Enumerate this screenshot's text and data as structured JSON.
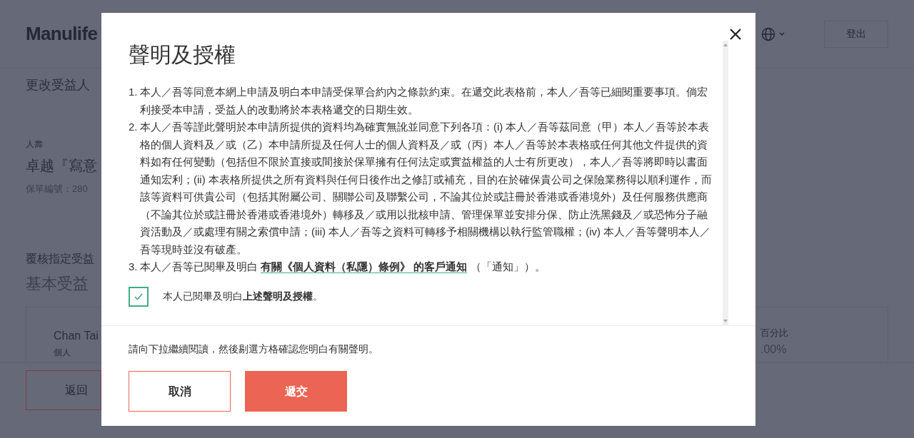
{
  "page": {
    "logo": "Manulife",
    "logout": "登出",
    "heading": "更改受益人",
    "category": "人壽",
    "plan": "卓越『寫意",
    "policy_label": "保單編號：280",
    "review": "覆核指定受益",
    "section": "基本受益",
    "beneficiary": {
      "name": "Chan Tai",
      "type": "個人",
      "percent_label": "百分比",
      "percent": ".00%"
    },
    "back": "返回"
  },
  "dialog": {
    "title": "聲明及授權",
    "items": [
      {
        "kind": "text",
        "number": "1.",
        "text": "本人／吾等同意本網上申請及明白本申請受保單合約內之條款約束。在遞交此表格前，本人／吾等已細閱重要事項。倘宏利接受本申請，受益人的改動將於本表格遞交的日期生效。"
      },
      {
        "kind": "text",
        "number": "2.",
        "text": "本人／吾等謹此聲明於本申請所提供的資料均為確實無訛並同意下列各項：(i) 本人／吾等茲同意（甲）本人／吾等於本表格的個人資料及／或（乙）本申請所提及任何人士的個人資料及／或（丙）本人／吾等於本表格或任何其他文件提供的資料如有任何變動（包括但不限於直接或間接於保單擁有任何法定或實益權益的人士有所更改），本人／吾等將即時以書面通知宏利；(ii) 本表格所提供之所有資料與任何日後作出之修訂或補充，目的在於確保貴公司之保險業務得以順利運作，而該等資料可供貴公司（包括其附屬公司、關聯公司及聯繫公司，不論其位於或註冊於香港或香港境外）及任何服務供應商（不論其位於或註冊於香港或香港境外）轉移及／或用以批核申請、管理保單並安排分保、防止洗黑錢及／或恐怖分子融資活動及／或處理有關之索償申請；(iii) 本人／吾等之資料可轉移予相關機構以執行監管職權；(iv) 本人／吾等聲明本人／吾等現時並沒有破產。"
      },
      {
        "kind": "link",
        "number": "3.",
        "text": "本人／吾等已閱畢及明白",
        "link": "有關《個人資料（私隱）條例》 的客戶通知",
        "after": "（「通知」）。"
      }
    ],
    "consent": {
      "checked": true,
      "label": "本人已閱畢及明白**上述聲明及授權**。"
    },
    "hint": "請向下拉繼續閱讀，然後剔選方格確認您明白有關聲明。",
    "cancel": "取消",
    "submit": "遞交"
  }
}
